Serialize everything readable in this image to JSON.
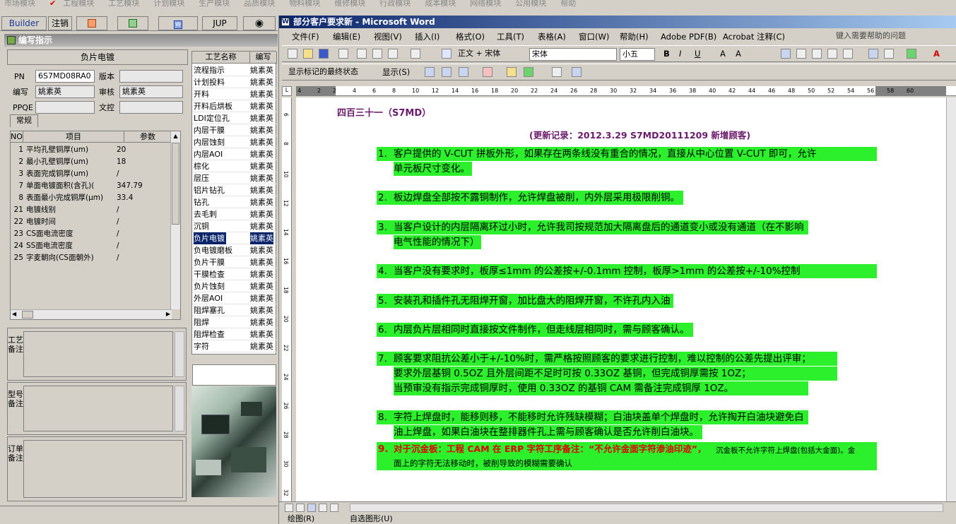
{
  "top_modules": [
    "市场模块",
    "工程模块",
    "工艺模块",
    "计划模块",
    "生产模块",
    "品质模块",
    "物料模块",
    "维修模块",
    "行政模块",
    "成本模块",
    "网络模块",
    "公用模块",
    "帮助"
  ],
  "left_toolbar": {
    "builder": "Builder",
    "logout": "注销",
    "jup": "JUP"
  },
  "panel_title": "编写指示",
  "header_title": "负片电镀",
  "form": {
    "pn_label": "PN",
    "pn_value": "6S7MD08RA0",
    "version_label": "版本",
    "version_value": "",
    "author_label": "编写",
    "author_value": "姚素英",
    "reviewer_label": "审核",
    "reviewer_value": "姚素英",
    "ppqe_label": "PPQE",
    "ppqe_value": "",
    "doc_control_label": "文控",
    "doc_control_value": ""
  },
  "tab_label": "常规",
  "params_table": {
    "headers": [
      "NO",
      "项目",
      "参数"
    ],
    "rows": [
      {
        "no": "1",
        "item": "平均孔壁铜厚(um)",
        "value": "20"
      },
      {
        "no": "2",
        "item": "最小孔壁铜厚(um)",
        "value": "18"
      },
      {
        "no": "3",
        "item": "表面完成铜厚(um)",
        "value": "/"
      },
      {
        "no": "7",
        "item": "单面电镀面积(含孔)(",
        "value": "347.79"
      },
      {
        "no": "8",
        "item": "表面最小完成铜厚(μm)",
        "value": "33.4"
      },
      {
        "no": "21",
        "item": "电镀线别",
        "value": "/"
      },
      {
        "no": "22",
        "item": "电镀时间",
        "value": "/"
      },
      {
        "no": "23",
        "item": "CS面电流密度",
        "value": "/"
      },
      {
        "no": "24",
        "item": "SS面电流密度",
        "value": "/"
      },
      {
        "no": "25",
        "item": "字麦朝向(CS面朝外)",
        "value": "/"
      }
    ]
  },
  "memos": {
    "process": "工艺备注",
    "model": "型号备注",
    "order": "订单备注"
  },
  "process_list": {
    "headers": [
      "工艺名称",
      "编写"
    ],
    "rows": [
      {
        "name": "流程指示",
        "author": "姚素英"
      },
      {
        "name": "计划投料",
        "author": "姚素英"
      },
      {
        "name": "开料",
        "author": "姚素英"
      },
      {
        "name": "开料后烘板",
        "author": "姚素英"
      },
      {
        "name": "LDI定位孔",
        "author": "姚素英"
      },
      {
        "name": "内层干膜",
        "author": "姚素英"
      },
      {
        "name": "内层蚀刻",
        "author": "姚素英"
      },
      {
        "name": "内层AOI",
        "author": "姚素英"
      },
      {
        "name": "棕化",
        "author": "姚素英"
      },
      {
        "name": "层压",
        "author": "姚素英"
      },
      {
        "name": "铝片钻孔",
        "author": "姚素英"
      },
      {
        "name": "钻孔",
        "author": "姚素英"
      },
      {
        "name": "去毛刺",
        "author": "姚素英"
      },
      {
        "name": "沉铜",
        "author": "姚素英"
      },
      {
        "name": "负片电镀",
        "author": "姚素英",
        "selected": true
      },
      {
        "name": "负电镀磨板",
        "author": "姚素英"
      },
      {
        "name": "负片干膜",
        "author": "姚素英"
      },
      {
        "name": "干膜检查",
        "author": "姚素英"
      },
      {
        "name": "负片蚀刻",
        "author": "姚素英"
      },
      {
        "name": "外层AOI",
        "author": "姚素英"
      },
      {
        "name": "阻焊塞孔",
        "author": "姚素英"
      },
      {
        "name": "阻焊",
        "author": "姚素英"
      },
      {
        "name": "阻焊检查",
        "author": "姚素英"
      },
      {
        "name": "字符",
        "author": "姚素英"
      }
    ]
  },
  "word": {
    "title": "部分客户要求新 - Microsoft Word",
    "menu": [
      "文件(F)",
      "编辑(E)",
      "视图(V)",
      "插入(I)",
      "格式(O)",
      "工具(T)",
      "表格(A)",
      "窗口(W)",
      "帮助(H)",
      "Adobe PDF(B)",
      "Acrobat 注释(C)"
    ],
    "help_placeholder": "键入需要帮助的问题",
    "style": "正文 + 宋体",
    "font": "宋体",
    "size": "小五",
    "review_mode": "显示标记的最终状态",
    "show": "显示(S)",
    "draw_label": "绘图(R)",
    "autoshape_label": "自选图形(U)",
    "ruler_numbers": [
      "4",
      "2",
      "2",
      "4",
      "6",
      "8",
      "10",
      "12",
      "14",
      "16",
      "18",
      "20",
      "22",
      "24",
      "26",
      "28",
      "30",
      "32",
      "34",
      "36",
      "38",
      "40",
      "42",
      "44",
      "46",
      "48",
      "50",
      "52",
      "54",
      "56",
      "58",
      "60"
    ],
    "vruler_numbers": [
      "6",
      "8",
      "10",
      "12",
      "14",
      "16",
      "18",
      "20",
      "22",
      "24",
      "26",
      "28",
      "30",
      "32"
    ],
    "doc": {
      "heading": "四百三十一（S7MD）",
      "update": "(更新记录：2012.3.29      S7MD20111209     新增顾客)",
      "items": [
        {
          "n": "1.",
          "lines": [
            "客户提供的 V-CUT 拼板外形，如果存在两条线没有重合的情况，直接从中心位置 V-CUT 即可，允许",
            "单元板尺寸变化。"
          ]
        },
        {
          "n": "2.",
          "lines": [
            "板边焊盘全部按不露铜制作，允许焊盘被削，内外层采用极限削铜。"
          ]
        },
        {
          "n": "3.",
          "lines": [
            "当客户设计的内层隔离环过小时，允许我司按规范加大隔离盘后的通道变小或没有通道（在不影响",
            "电气性能的情况下）"
          ]
        },
        {
          "n": "4.",
          "lines": [
            "当客户没有要求时，板厚≤1mm 的公差按+/-0.1mm 控制，板厚>1mm 的公差按+/-10%控制"
          ]
        },
        {
          "n": "5.",
          "lines": [
            "安装孔和插件孔无阻焊开窗，加比盘大的阻焊开窗，不许孔内入油"
          ]
        },
        {
          "n": "6.",
          "lines": [
            "内层负片层相同时直接按文件制作，但走线层相同时，需与顾客确认。"
          ]
        },
        {
          "n": "7.",
          "lines": [
            "顾客要求阻抗公差小于+/-10%时，需严格按照顾客的要求进行控制，难以控制的公差先提出评审；",
            "要求外层基铜 0.5OZ 且外层间距不足时可按 0.33OZ 基铜，但完成铜厚需按 1OZ；",
            "当预审没有指示完成铜厚时，使用 0.33OZ 的基铜 CAM 需备注完成铜厚 1OZ。"
          ]
        },
        {
          "n": "8.",
          "lines": [
            "字符上焊盘时，能移则移，不能移时允许残缺模糊；白油块盖单个焊盘时，允许掏开白油块避免白",
            "油上焊盘，如果白油块在整排器件孔上需与顾客确认是否允许削白油块。"
          ]
        }
      ],
      "item9": {
        "n": "9.",
        "red": "对于沉金板：工程 CAM 在 ERP 字符工序备注：“不允许金面字符渗油印迹”，",
        "normal": "沉金板不允许字符上焊盘(包括大金面)。金",
        "line2": "面上的字符无法移动时，被削导致的模糊需要确认"
      }
    }
  },
  "colors": {
    "highlight": "#2cf02c",
    "heading": "#6a1a6a",
    "red": "#e00000",
    "selection": "#0a246a"
  }
}
